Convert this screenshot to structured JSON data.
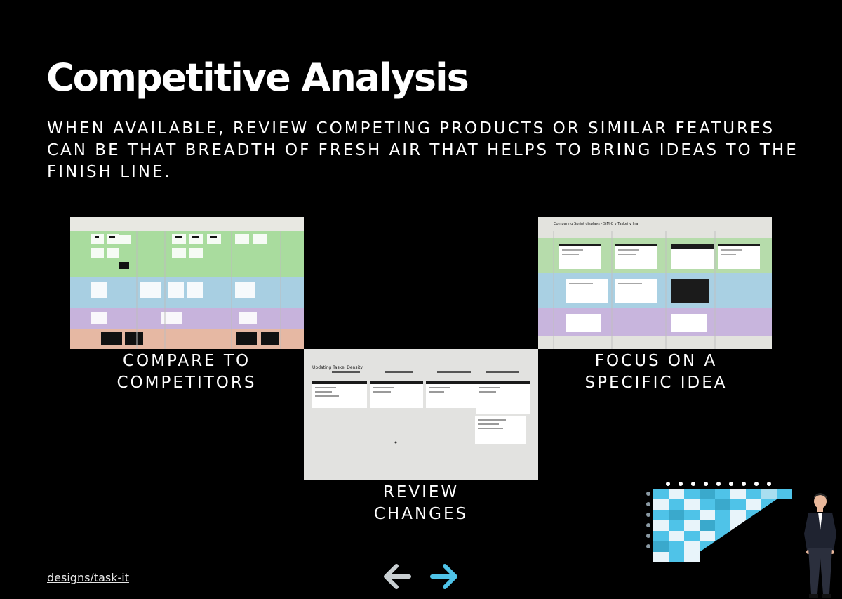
{
  "page": {
    "title": "Competitive Analysis",
    "subtitle": "WHEN AVAILABLE, REVIEW COMPETING PRODUCTS OR SIMILAR FEATURES CAN BE THAT BREADTH OF FRESH AIR THAT HELPS TO BRING IDEAS TO THE FINISH LINE."
  },
  "panels": [
    {
      "caption": "COMPARE TO\nCOMPETITORS"
    },
    {
      "caption": "REVIEW\nCHANGES",
      "photo_heading": "Updating Taskel Density"
    },
    {
      "caption": "FOCUS ON A\nSPECIFIC IDEA",
      "photo_heading": "Comparing Sprint displays - SIM-C v Taskei v Jira"
    }
  ],
  "footer": {
    "link_text": "designs/task-it",
    "prev_icon": "arrow-left-icon",
    "next_icon": "arrow-right-icon"
  },
  "colors": {
    "accent": "#4fc3e8",
    "nav_prev": "#c9cfd2",
    "nav_next": "#4fc3e8"
  }
}
